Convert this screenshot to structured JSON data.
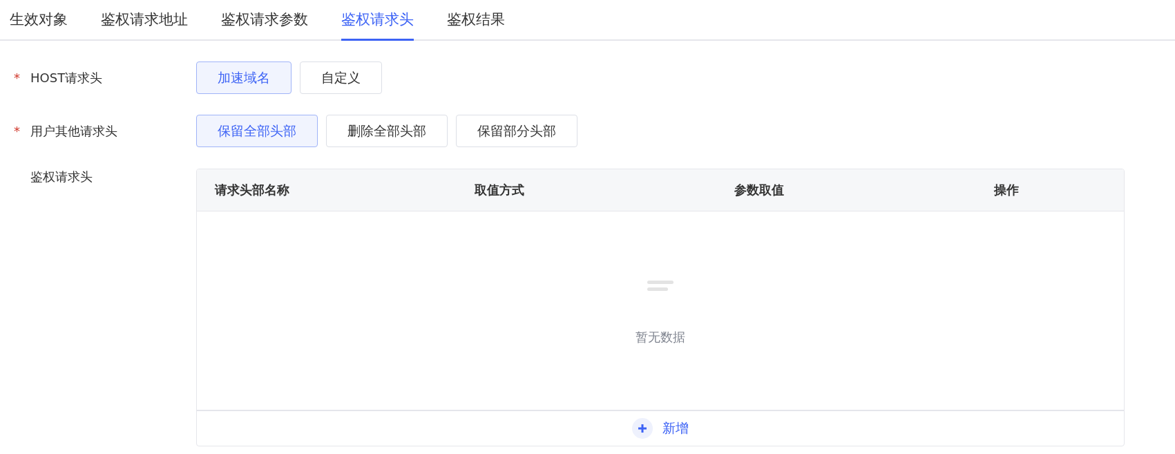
{
  "tabs": [
    {
      "label": "生效对象",
      "selected": false
    },
    {
      "label": "鉴权请求地址",
      "selected": false
    },
    {
      "label": "鉴权请求参数",
      "selected": false
    },
    {
      "label": "鉴权请求头",
      "selected": true
    },
    {
      "label": "鉴权结果",
      "selected": false
    }
  ],
  "form": [
    {
      "kind": "choice",
      "label": "HOST请求头",
      "required_mark": "*",
      "options": [
        {
          "label": "加速域名",
          "selected": true
        },
        {
          "label": "自定义",
          "selected": false
        }
      ]
    },
    {
      "kind": "choice",
      "label": "用户其他请求头",
      "required_mark": "*",
      "options": [
        {
          "label": "保留全部头部",
          "selected": true
        },
        {
          "label": "删除全部头部",
          "selected": false
        },
        {
          "label": "保留部分头部",
          "selected": false
        }
      ]
    },
    {
      "kind": "table",
      "label": "鉴权请求头",
      "columns": [
        "请求头部名称",
        "取值方式",
        "参数取值",
        "操作"
      ],
      "empty_text": "暂无数据",
      "add_label": "新增"
    }
  ]
}
